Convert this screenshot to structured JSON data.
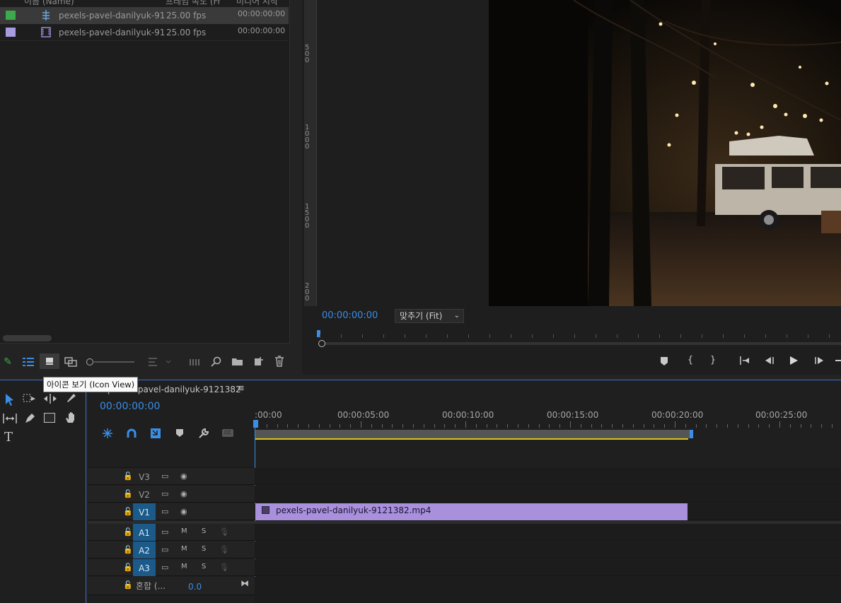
{
  "project": {
    "columns": [
      "이름 (Name)",
      "프레임 속도 (Fr",
      "미디어 시작"
    ],
    "rows": [
      {
        "color": "#3ca94a",
        "name": "pexels-pavel-danilyuk-91",
        "fps": "25.00 fps",
        "start": "00:00:00:00",
        "icon": "sequence-icon"
      },
      {
        "color": "#a99be0",
        "name": "pexels-pavel-danilyuk-91",
        "fps": "25.00 fps",
        "start": "00:00:00:00",
        "icon": "video-clip-icon"
      }
    ],
    "tooltip": "아이콘 보기 (Icon View)"
  },
  "monitor": {
    "timecode": "00:00:00:00",
    "zoom_label": "맞추기 (Fit)",
    "ruler_marks": [
      "500",
      "1000",
      "1500",
      "200"
    ]
  },
  "timeline": {
    "sequence_name": "pexels-pavel-danilyuk-9121382",
    "timecode": "00:00:00:00",
    "ruler": [
      ":00:00",
      "00:00:05:00",
      "00:00:10:00",
      "00:00:15:00",
      "00:00:20:00",
      "00:00:25:00"
    ],
    "video_tracks": [
      {
        "name": "V3",
        "active": false
      },
      {
        "name": "V2",
        "active": false
      },
      {
        "name": "V1",
        "active": true
      }
    ],
    "audio_tracks": [
      {
        "name": "A1",
        "m": "M",
        "s": "S"
      },
      {
        "name": "A2",
        "m": "M",
        "s": "S"
      },
      {
        "name": "A3",
        "m": "M",
        "s": "S"
      }
    ],
    "mix_label": "혼합 (...",
    "mix_value": "0.0",
    "clip_name": "pexels-pavel-danilyuk-9121382.mp4",
    "clip_color": "#a990dd",
    "accent": "#3a8ee6"
  }
}
